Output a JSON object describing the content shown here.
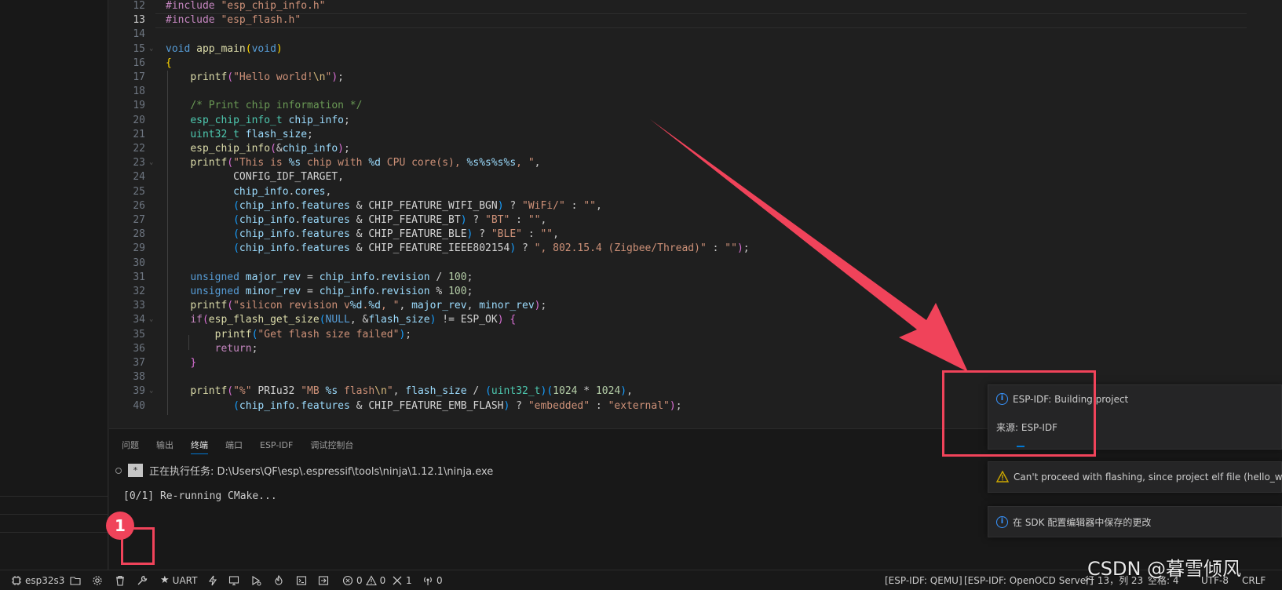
{
  "editor": {
    "current_line": 13,
    "lines": [
      {
        "n": 12,
        "html": "<span class=\"k-pp\">#include</span> <span class=\"k-str\">\"esp_chip_info.h\"</span>"
      },
      {
        "n": 13,
        "html": "<span class=\"k-pp\">#include</span> <span class=\"k-str\">\"esp_flash.h\"</span>"
      },
      {
        "n": 14,
        "html": ""
      },
      {
        "n": 15,
        "html": "<span class=\"k-kw\">void</span> <span class=\"k-fn\">app_main</span><span class=\"k-br\">(</span><span class=\"k-kw\">void</span><span class=\"k-br\">)</span>"
      },
      {
        "n": 16,
        "html": "<span class=\"k-br\">{</span>"
      },
      {
        "n": 17,
        "html": "    <span class=\"k-fn\">printf</span><span class=\"k-br2\">(</span><span class=\"k-str\">\"Hello world!</span><span class=\"k-esc\">\\n</span><span class=\"k-str\">\"</span><span class=\"k-br2\">)</span>;"
      },
      {
        "n": 18,
        "html": ""
      },
      {
        "n": 19,
        "html": "    <span class=\"k-cm\">/* Print chip information */</span>"
      },
      {
        "n": 20,
        "html": "    <span class=\"k-ty\">esp_chip_info_t</span> <span class=\"k-var\">chip_info</span>;"
      },
      {
        "n": 21,
        "html": "    <span class=\"k-ty\">uint32_t</span> <span class=\"k-var\">flash_size</span>;"
      },
      {
        "n": 22,
        "html": "    <span class=\"k-fn\">esp_chip_info</span><span class=\"k-br2\">(</span>&amp;<span class=\"k-var\">chip_info</span><span class=\"k-br2\">)</span>;"
      },
      {
        "n": 23,
        "html": "    <span class=\"k-fn\">printf</span><span class=\"k-br2\">(</span><span class=\"k-str\">\"This is </span><span class=\"k-fmt\">%s</span><span class=\"k-str\"> chip with </span><span class=\"k-fmt\">%d</span><span class=\"k-str\"> CPU core(s), </span><span class=\"k-fmt\">%s%s%s%s</span><span class=\"k-str\">, \"</span>,"
      },
      {
        "n": 24,
        "html": "           <span class=\"k-mac\">CONFIG_IDF_TARGET</span>,"
      },
      {
        "n": 25,
        "html": "           <span class=\"k-var\">chip_info</span>.<span class=\"k-var\">cores</span>,"
      },
      {
        "n": 26,
        "html": "           <span class=\"k-br3\">(</span><span class=\"k-var\">chip_info</span>.<span class=\"k-var\">features</span> &amp; <span class=\"k-mac\">CHIP_FEATURE_WIFI_BGN</span><span class=\"k-br3\">)</span> ? <span class=\"k-str\">\"WiFi/\"</span> : <span class=\"k-str\">\"\"</span>,"
      },
      {
        "n": 27,
        "html": "           <span class=\"k-br3\">(</span><span class=\"k-var\">chip_info</span>.<span class=\"k-var\">features</span> &amp; <span class=\"k-mac\">CHIP_FEATURE_BT</span><span class=\"k-br3\">)</span> ? <span class=\"k-str\">\"BT\"</span> : <span class=\"k-str\">\"\"</span>,"
      },
      {
        "n": 28,
        "html": "           <span class=\"k-br3\">(</span><span class=\"k-var\">chip_info</span>.<span class=\"k-var\">features</span> &amp; <span class=\"k-mac\">CHIP_FEATURE_BLE</span><span class=\"k-br3\">)</span> ? <span class=\"k-str\">\"BLE\"</span> : <span class=\"k-str\">\"\"</span>,"
      },
      {
        "n": 29,
        "html": "           <span class=\"k-br3\">(</span><span class=\"k-var\">chip_info</span>.<span class=\"k-var\">features</span> &amp; <span class=\"k-mac\">CHIP_FEATURE_IEEE802154</span><span class=\"k-br3\">)</span> ? <span class=\"k-str\">\", 802.15.4 (Zigbee/Thread)\"</span> : <span class=\"k-str\">\"\"</span><span class=\"k-br2\">)</span>;"
      },
      {
        "n": 30,
        "html": ""
      },
      {
        "n": 31,
        "html": "    <span class=\"k-kw\">unsigned</span> <span class=\"k-var\">major_rev</span> = <span class=\"k-var\">chip_info</span>.<span class=\"k-var\">revision</span> / <span class=\"k-num\">100</span>;"
      },
      {
        "n": 32,
        "html": "    <span class=\"k-kw\">unsigned</span> <span class=\"k-var\">minor_rev</span> = <span class=\"k-var\">chip_info</span>.<span class=\"k-var\">revision</span> % <span class=\"k-num\">100</span>;"
      },
      {
        "n": 33,
        "html": "    <span class=\"k-fn\">printf</span><span class=\"k-br2\">(</span><span class=\"k-str\">\"silicon revision v</span><span class=\"k-fmt\">%d</span><span class=\"k-str\">.</span><span class=\"k-fmt\">%d</span><span class=\"k-str\">, \"</span>, <span class=\"k-var\">major_rev</span>, <span class=\"k-var\">minor_rev</span><span class=\"k-br2\">)</span>;"
      },
      {
        "n": 34,
        "html": "    <span class=\"k-pp\">if</span><span class=\"k-br2\">(</span><span class=\"k-fn\">esp_flash_get_size</span><span class=\"k-br3\">(</span><span class=\"k-kw\">NULL</span>, &amp;<span class=\"k-var\">flash_size</span><span class=\"k-br3\">)</span> != <span class=\"k-mac\">ESP_OK</span><span class=\"k-br2\">)</span> <span class=\"k-br2\">{</span>"
      },
      {
        "n": 35,
        "html": "        <span class=\"k-fn\">printf</span><span class=\"k-br3\">(</span><span class=\"k-str\">\"Get flash size failed\"</span><span class=\"k-br3\">)</span>;"
      },
      {
        "n": 36,
        "html": "        <span class=\"k-pp\">return</span>;"
      },
      {
        "n": 37,
        "html": "    <span class=\"k-br2\">}</span>"
      },
      {
        "n": 38,
        "html": ""
      },
      {
        "n": 39,
        "html": "    <span class=\"k-fn\">printf</span><span class=\"k-br2\">(</span><span class=\"k-str\">\"%\"</span> <span class=\"k-mac\">PRIu32</span> <span class=\"k-str\">\"MB </span><span class=\"k-fmt\">%s</span><span class=\"k-str\"> flash</span><span class=\"k-esc\">\\n</span><span class=\"k-str\">\"</span>, <span class=\"k-var\">flash_size</span> / <span class=\"k-br3\">(</span><span class=\"k-ty\">uint32_t</span><span class=\"k-br3\">)(</span><span class=\"k-num\">1024</span> * <span class=\"k-num\">1024</span><span class=\"k-br3\">)</span>,"
      },
      {
        "n": 40,
        "html": "           <span class=\"k-br3\">(</span><span class=\"k-var\">chip_info</span>.<span class=\"k-var\">features</span> &amp; <span class=\"k-mac\">CHIP_FEATURE_EMB_FLASH</span><span class=\"k-br3\">)</span> ? <span class=\"k-str\">\"embedded\"</span> : <span class=\"k-str\">\"external\"</span><span class=\"k-br2\">)</span>;"
      }
    ]
  },
  "panel": {
    "tabs": [
      {
        "label": "问题",
        "active": false
      },
      {
        "label": "输出",
        "active": false
      },
      {
        "label": "终端",
        "active": true
      },
      {
        "label": "端口",
        "active": false
      },
      {
        "label": "ESP-IDF",
        "active": false
      },
      {
        "label": "调试控制台",
        "active": false
      }
    ],
    "terminal": {
      "task_badge": "*",
      "task_line": "正在执行任务: D:\\Users\\QF\\esp\\.espressif\\tools\\ninja\\1.12.1\\ninja.exe",
      "output_line": "[0/1] Re-running CMake..."
    }
  },
  "notifications": {
    "building": {
      "title": "ESP-IDF: Building project",
      "source": "来源: ESP-IDF"
    },
    "warning": {
      "text": "Can't proceed with flashing, since project elf file (hello_world"
    },
    "sdk": {
      "text": "在 SDK 配置编辑器中保存的更改"
    }
  },
  "statusbar": {
    "target": "esp32s3",
    "uart": "UART",
    "errors": "0",
    "warnings": "0",
    "tools_count": "1",
    "ports_count": "0",
    "qemu": "[ESP-IDF: QEMU]",
    "openocd": "[ESP-IDF: OpenOCD Server]",
    "position": "行 13，列 23",
    "spaces": "空格: 4",
    "encoding": "UTF-8",
    "eol": "CRLF"
  },
  "annotation": {
    "badge": "1"
  },
  "watermark": "CSDN @暮雪倾风",
  "colors": {
    "accent": "#0078d4",
    "annotation": "#f0435a",
    "info": "#3794ff",
    "warning": "#cca700"
  }
}
